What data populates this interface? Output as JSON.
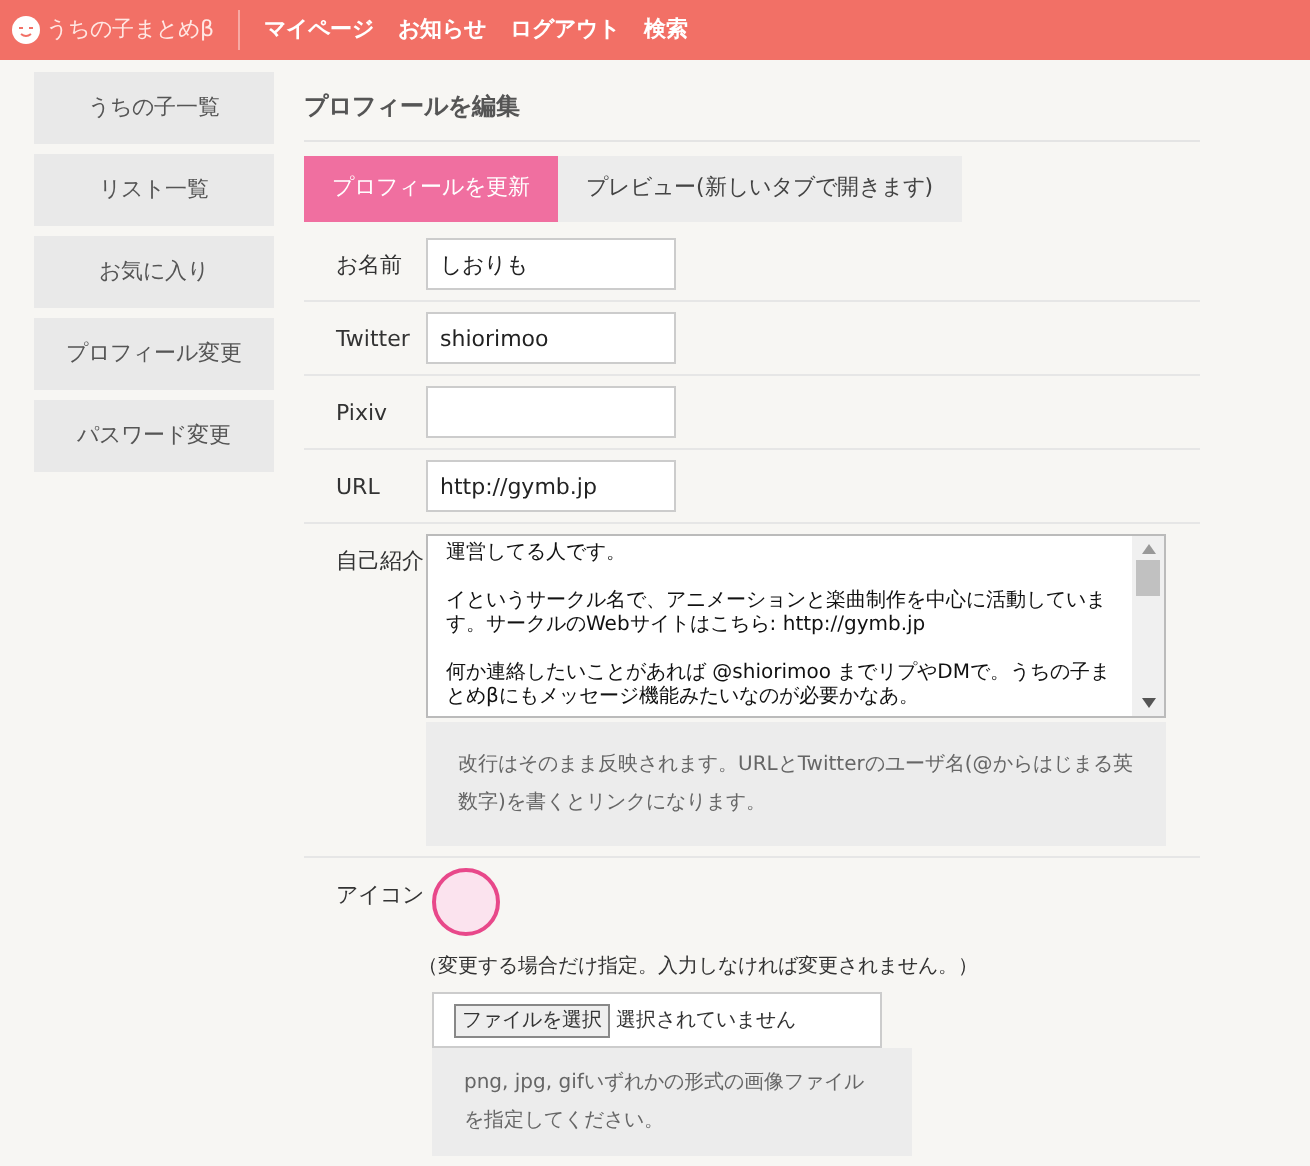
{
  "header": {
    "logo": "うちの子まとめβ",
    "nav": [
      "マイページ",
      "お知らせ",
      "ログアウト",
      "検索"
    ]
  },
  "sidebar": {
    "items": [
      {
        "label": "うちの子一覧",
        "selected": false
      },
      {
        "label": "リスト一覧",
        "selected": false
      },
      {
        "label": "お気に入り",
        "selected": false
      },
      {
        "label": "プロフィール変更",
        "selected": false
      },
      {
        "label": "パスワード変更",
        "selected": false
      }
    ]
  },
  "page_title": "プロフィールを編集",
  "tabs": [
    {
      "label": "プロフィールを更新",
      "selected": true
    },
    {
      "label": "プレビュー(新しいタブで開きます)",
      "selected": false
    }
  ],
  "fields": [
    {
      "label": "お名前",
      "value": "しおりも"
    },
    {
      "label": "Twitter",
      "value": "shiorimoo"
    },
    {
      "label": "Pixiv"
    },
    {
      "label": "URL",
      "value": "http://gymb.jp"
    }
  ],
  "bio": {
    "label": "自己紹介",
    "paragraphs": [
      "運営してる人です。",
      "イというサークル名で、アニメーションと楽曲制作を中心に活動しています。サークルのWebサイトはこちら: http://gymb.jp",
      "何か連絡したいことがあれば @shiorimoo までリプやDMで。うちの子まとめβにもメッセージ機能みたいなのが必要かなあ。"
    ],
    "hint": "改行はそのまま反映されます。URLとTwitterのユーザ名(@からはじまる英数字)を書くとリンクになります。"
  },
  "icon": {
    "label": "アイコン",
    "note": "（変更する場合だけ指定。入力しなければ変更されません。）",
    "file_button": "ファイルを選択",
    "file_status": "選択されていません",
    "hint": "png, jpg, gifいずれかの形式の画像ファイルを指定してください。"
  }
}
